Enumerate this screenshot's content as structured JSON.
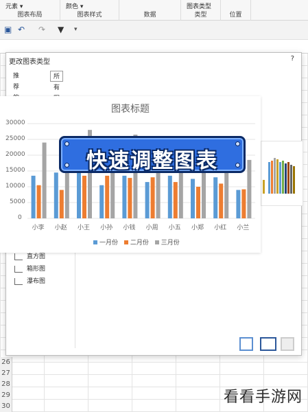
{
  "ribbon": {
    "groups": [
      {
        "top": "元素 ▾",
        "label": "图表布局"
      },
      {
        "top": "颜色 ▾",
        "label": "图表样式"
      },
      {
        "top": "",
        "label": "数据"
      },
      {
        "top": "图表类型",
        "label": "类型"
      },
      {
        "top": "",
        "label": "位置"
      }
    ]
  },
  "dialog": {
    "title": "更改图表类型",
    "help": "?",
    "tabs": [
      "推荐的图表",
      "所有图表"
    ],
    "left_items": [
      "直方图",
      "箱形图",
      "瀑布图"
    ]
  },
  "chart_data": {
    "type": "bar",
    "title": "图表标题",
    "categories": [
      "小李",
      "小赵",
      "小王",
      "小孙",
      "小钱",
      "小周",
      "小五",
      "小郑",
      "小红",
      "小兰"
    ],
    "series": [
      {
        "name": "一月份",
        "values": [
          13500,
          14500,
          14500,
          10500,
          13500,
          11500,
          13500,
          12500,
          13000,
          9000
        ]
      },
      {
        "name": "二月份",
        "values": [
          10500,
          9000,
          13500,
          13500,
          12800,
          13000,
          11500,
          10000,
          11000,
          9200
        ]
      },
      {
        "name": "三月份",
        "values": [
          24000,
          17000,
          28000,
          17000,
          26500,
          17500,
          17500,
          17500,
          17000,
          18500
        ]
      }
    ],
    "yticks": [
      "30000",
      "25000",
      "20000",
      "15000",
      "10000",
      "5000",
      "0"
    ],
    "ylim": [
      0,
      30000
    ],
    "colors": [
      "#5b9bd5",
      "#ed7d31",
      "#a5a5a5"
    ]
  },
  "banner": {
    "text": "快速调整图表"
  },
  "rows": [
    "26",
    "27",
    "28",
    "29",
    "30"
  ],
  "watermark": "看看手游网"
}
